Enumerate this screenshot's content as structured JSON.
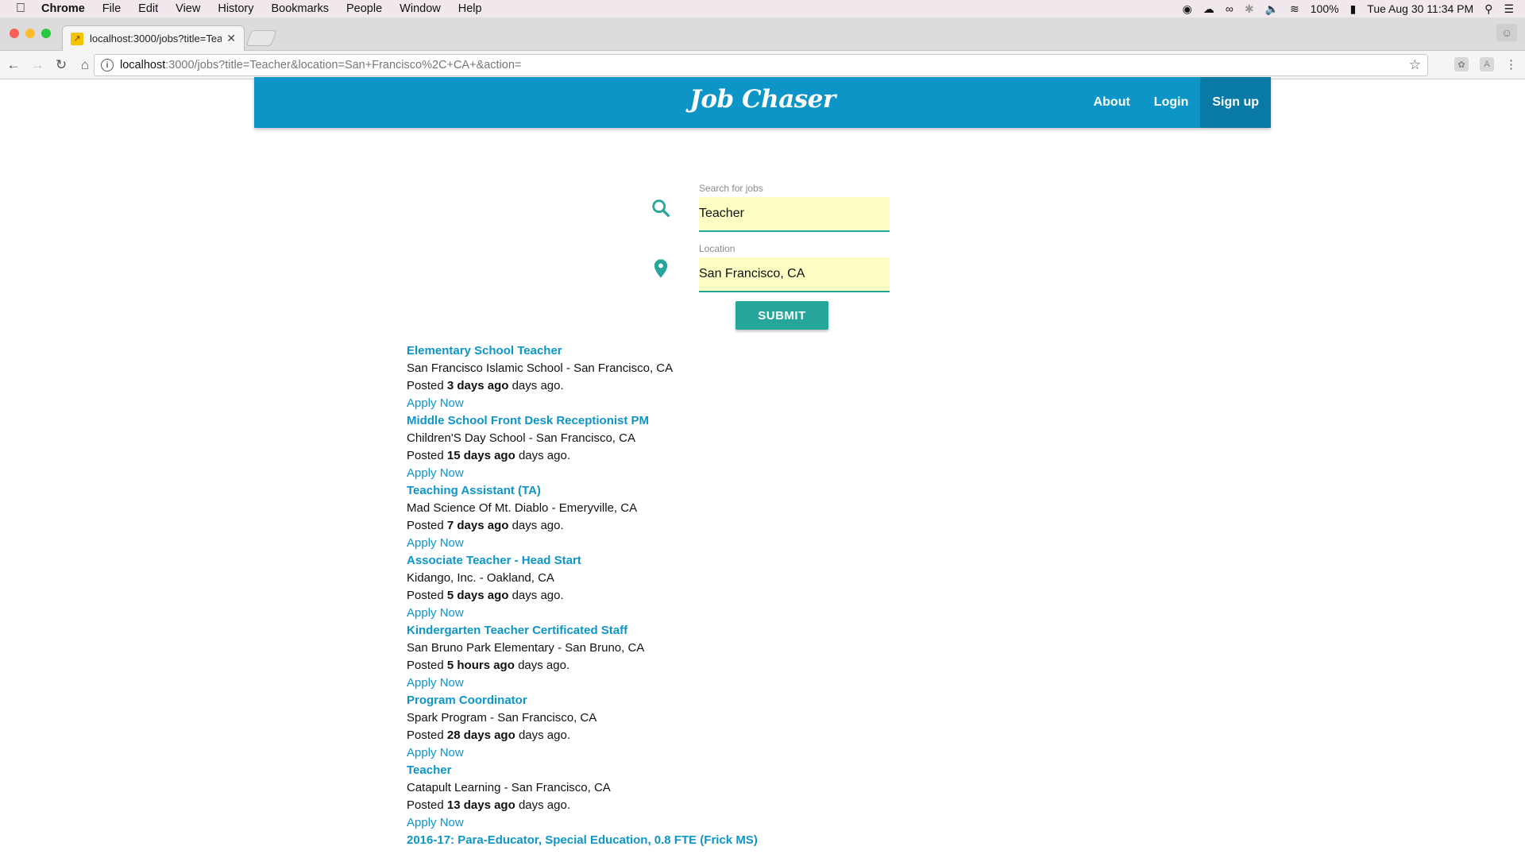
{
  "menubar": {
    "app": "Chrome",
    "items": [
      "File",
      "Edit",
      "View",
      "History",
      "Bookmarks",
      "People",
      "Window",
      "Help"
    ],
    "battery": "100%",
    "datetime": "Tue Aug 30  11:34 PM"
  },
  "browser": {
    "tab_title": "localhost:3000/jobs?title=Tea",
    "url_host": "localhost",
    "url_rest": ":3000/jobs?title=Teacher&location=San+Francisco%2C+CA+&action="
  },
  "site": {
    "brand": "Job Chaser",
    "nav": {
      "about": "About",
      "login": "Login",
      "signup": "Sign up"
    },
    "accent": "#0e95c8"
  },
  "search": {
    "title_label": "Search for jobs",
    "title_value": "Teacher",
    "location_label": "Location",
    "location_value": "San Francisco, CA",
    "submit": "SUBMIT"
  },
  "jobs": [
    {
      "title": "Elementary School Teacher",
      "company": "San Francisco Islamic School - San Francisco, CA",
      "posted_prefix": "Posted",
      "age": "3 days ago",
      "posted_suffix": "days ago.",
      "apply": "Apply Now"
    },
    {
      "title": "Middle School Front Desk Receptionist PM",
      "company": "Children'S Day School - San Francisco, CA",
      "posted_prefix": "Posted",
      "age": "15 days ago",
      "posted_suffix": "days ago.",
      "apply": "Apply Now"
    },
    {
      "title": "Teaching Assistant (TA)",
      "company": "Mad Science Of Mt. Diablo - Emeryville, CA",
      "posted_prefix": "Posted",
      "age": "7 days ago",
      "posted_suffix": "days ago.",
      "apply": "Apply Now"
    },
    {
      "title": "Associate Teacher - Head Start",
      "company": "Kidango, Inc. - Oakland, CA",
      "posted_prefix": "Posted",
      "age": "5 days ago",
      "posted_suffix": "days ago.",
      "apply": "Apply Now"
    },
    {
      "title": "Kindergarten Teacher Certificated Staff",
      "company": "San Bruno Park Elementary - San Bruno, CA",
      "posted_prefix": "Posted",
      "age": "5 hours ago",
      "posted_suffix": "days ago.",
      "apply": "Apply Now"
    },
    {
      "title": "Program Coordinator",
      "company": "Spark Program - San Francisco, CA",
      "posted_prefix": "Posted",
      "age": "28 days ago",
      "posted_suffix": "days ago.",
      "apply": "Apply Now"
    },
    {
      "title": "Teacher",
      "company": "Catapult Learning - San Francisco, CA",
      "posted_prefix": "Posted",
      "age": "13 days ago",
      "posted_suffix": "days ago.",
      "apply": "Apply Now"
    },
    {
      "title": "2016-17: Para-Educator, Special Education, 0.8 FTE (Frick MS)"
    }
  ]
}
